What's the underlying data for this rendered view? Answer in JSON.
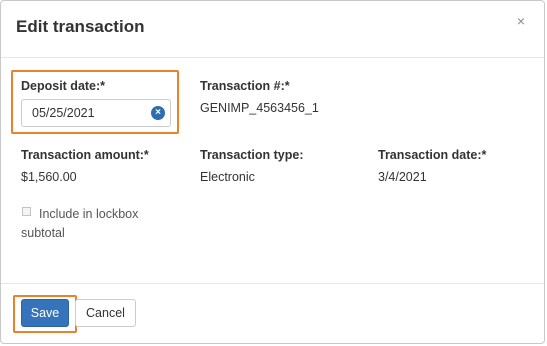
{
  "dialog": {
    "title": "Edit transaction",
    "close_glyph": "×"
  },
  "fields": {
    "deposit_date": {
      "label": "Deposit date:*",
      "value": "05/25/2021",
      "clear_glyph": "×"
    },
    "transaction_number": {
      "label": "Transaction #:*",
      "value": "GENIMP_4563456_1"
    },
    "transaction_amount": {
      "label": "Transaction amount:*",
      "value": "$1,560.00"
    },
    "transaction_type": {
      "label": "Transaction type:",
      "value": "Electronic"
    },
    "transaction_date": {
      "label": "Transaction date:*",
      "value": "3/4/2021"
    },
    "include_lockbox": {
      "label": "Include in lockbox subtotal",
      "checked": false
    }
  },
  "footer": {
    "save_label": "Save",
    "cancel_label": "Cancel"
  },
  "colors": {
    "highlight": "#e8822d",
    "primary": "#3574bb"
  }
}
